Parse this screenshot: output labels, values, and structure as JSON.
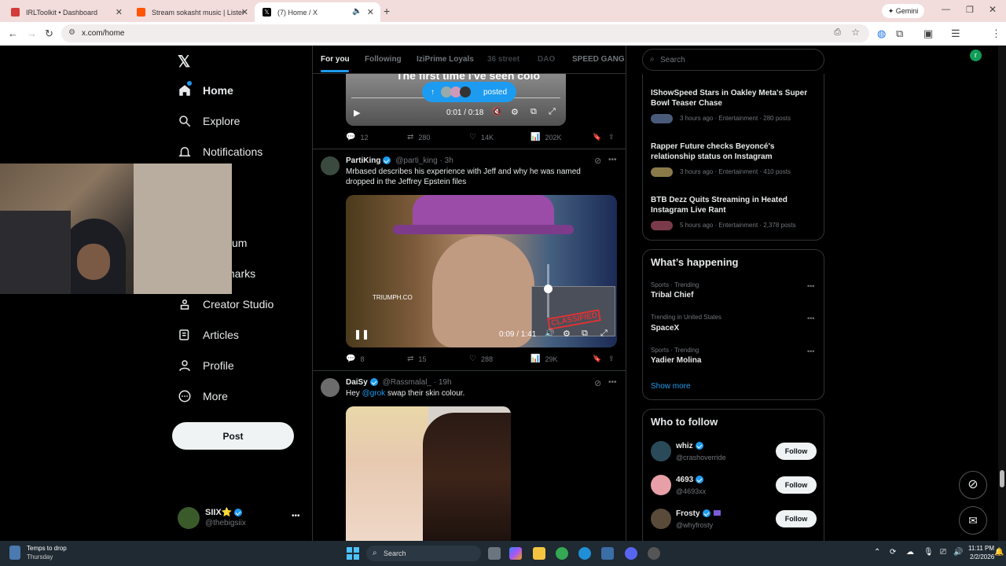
{
  "browser": {
    "tabs": [
      {
        "title": "IRLToolkit • Dashboard",
        "color": "#d43a3a"
      },
      {
        "title": "Stream sokasht music | Listen t",
        "color": "#ff5500"
      },
      {
        "title": "(7) Home / X",
        "color": "#000000"
      }
    ],
    "url": "x.com/home",
    "gemini_label": "Gemini",
    "profile_initial": "r"
  },
  "nav": {
    "items": [
      {
        "label": "Home",
        "icon": "home-icon"
      },
      {
        "label": "Explore",
        "icon": "search-icon"
      },
      {
        "label": "Notifications",
        "icon": "bell-icon"
      },
      {
        "label": "um",
        "icon": "premium-icon"
      },
      {
        "label": "marks",
        "icon": "bookmark-icon"
      },
      {
        "label": "Creator Studio",
        "icon": "creator-icon"
      },
      {
        "label": "Articles",
        "icon": "article-icon"
      },
      {
        "label": "Profile",
        "icon": "person-icon"
      },
      {
        "label": "More",
        "icon": "more-circle-icon"
      }
    ],
    "post_label": "Post",
    "account": {
      "name": "SIIX⭐",
      "handle": "@thebigsiix"
    }
  },
  "timeline": {
    "tabs": [
      "For you",
      "Following",
      "IziPrime Loyals",
      "36 street",
      "DAO",
      "SPEED GANG"
    ],
    "top_video": {
      "caption": "The first time i've seen colo",
      "time": "0:01 / 0:18",
      "posted_label": "posted"
    },
    "top_stats": {
      "replies": "12",
      "reposts": "280",
      "likes": "14K",
      "views": "202K"
    },
    "post1": {
      "name": "PartiKing",
      "handle": "@parti_king",
      "time": "· 3h",
      "text": "Mrbased describes his experience with Jeff and why he was named dropped in the Jeffrey Epstein files",
      "video_time": "0:09 / 1:41",
      "watermark": "TRIUMPH.CO",
      "stamp": "CLASSIFIED",
      "stats": {
        "replies": "8",
        "reposts": "15",
        "likes": "288",
        "views": "29K"
      }
    },
    "post2": {
      "name": "DaiSy",
      "handle": "@Rassmalal_",
      "time": "· 19h",
      "mention": "@grok",
      "text": "swap their skin colour.",
      "prefix": "Hey "
    }
  },
  "right": {
    "search_placeholder": "Search",
    "news": [
      {
        "title": "IShowSpeed Stars in Oakley Meta's Super Bowl Teaser Chase",
        "meta": "3 hours ago · Entertainment · 280 posts"
      },
      {
        "title": "Rapper Future checks Beyoncé's relationship status on Instagram",
        "meta": "3 hours ago · Entertainment · 410 posts"
      },
      {
        "title": "BTB Dezz Quits Streaming in Heated Instagram Live Rant",
        "meta": "5 hours ago · Entertainment · 2,378 posts"
      }
    ],
    "happening_title": "What’s happening",
    "trends": [
      {
        "context": "Sports · Trending",
        "name": "Tribal Chief"
      },
      {
        "context": "Trending in United States",
        "name": "SpaceX"
      },
      {
        "context": "Sports · Trending",
        "name": "Yadier Molina"
      }
    ],
    "show_more": "Show more",
    "follow_title": "Who to follow",
    "follow": [
      {
        "name": "whiz",
        "handle": "@crashoverride",
        "btn": "Follow"
      },
      {
        "name": "4693",
        "handle": "@4693xx",
        "btn": "Follow"
      },
      {
        "name": "Frosty",
        "handle": "@whyfrosty",
        "btn": "Follow"
      }
    ]
  },
  "taskbar": {
    "weather_title": "Temps to drop",
    "weather_sub": "Thursday",
    "search": "Search",
    "time": "11:11 PM",
    "date": "2/2/2026"
  }
}
